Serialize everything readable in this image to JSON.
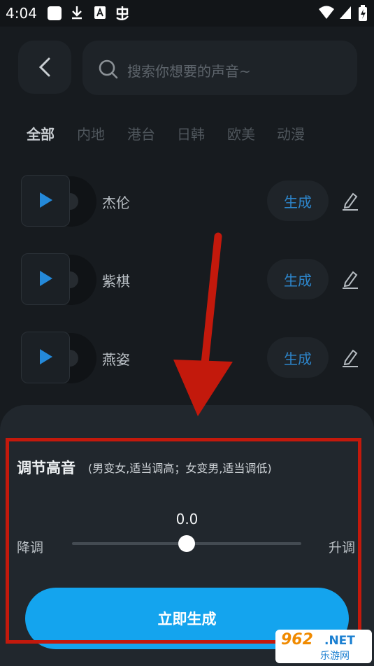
{
  "status_bar": {
    "time": "4:04",
    "icons": [
      "app-square-icon",
      "download-icon",
      "a-box-icon",
      "bug-app-icon",
      "wifi-icon",
      "signal-icon",
      "battery-icon"
    ]
  },
  "header": {
    "back_icon": "chevron-left-icon",
    "search_placeholder": "搜索你想要的声音~"
  },
  "tabs": [
    {
      "label": "全部",
      "active": true
    },
    {
      "label": "内地",
      "active": false
    },
    {
      "label": "港台",
      "active": false
    },
    {
      "label": "日韩",
      "active": false
    },
    {
      "label": "欧美",
      "active": false
    },
    {
      "label": "动漫",
      "active": false
    }
  ],
  "voices": [
    {
      "name": "杰伦",
      "action_label": "生成"
    },
    {
      "name": "紫棋",
      "action_label": "生成"
    },
    {
      "name": "燕姿",
      "action_label": "生成"
    }
  ],
  "sheet": {
    "title": "调节高音",
    "hint": "(男变女,适当调高；女变男,适当调低)",
    "value": "0.0",
    "down_label": "降调",
    "up_label": "升调",
    "slider_position": 0.5,
    "cta_label": "立即生成"
  },
  "watermark": {
    "brand": "962",
    "suffix": ".NET",
    "cn": "乐游网"
  },
  "colors": {
    "accent_blue": "#14a4ee",
    "link_blue": "#2d86cc",
    "highlight_red": "#c3190c",
    "background": "#171b1f",
    "sheet_bg": "#21272d"
  }
}
